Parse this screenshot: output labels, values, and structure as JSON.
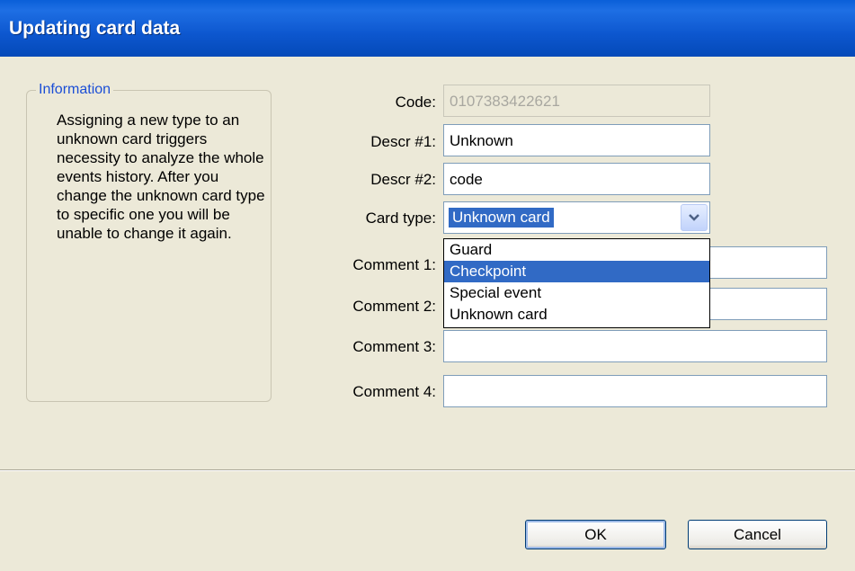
{
  "window": {
    "title": "Updating card data"
  },
  "info": {
    "legend": "Information",
    "text": "Assigning a new type to an unknown card triggers necessity to analyze the whole events history. After you change the unknown card type to specific one you will be unable to change it again."
  },
  "form": {
    "code": {
      "label": "Code:",
      "value": "0107383422621"
    },
    "descr1": {
      "label": "Descr #1:",
      "value": "Unknown"
    },
    "descr2": {
      "label": "Descr #2:",
      "value": "code"
    },
    "card_type": {
      "label": "Card type:",
      "value": "Unknown card",
      "options": [
        "Guard",
        "Checkpoint",
        "Special event",
        "Unknown card"
      ],
      "highlighted": "Checkpoint"
    },
    "comment1": {
      "label": "Comment 1:",
      "value": ""
    },
    "comment2": {
      "label": "Comment 2:",
      "value": ""
    },
    "comment3": {
      "label": "Comment 3:",
      "value": ""
    },
    "comment4": {
      "label": "Comment 4:",
      "value": ""
    }
  },
  "buttons": {
    "ok": "OK",
    "cancel": "Cancel"
  }
}
